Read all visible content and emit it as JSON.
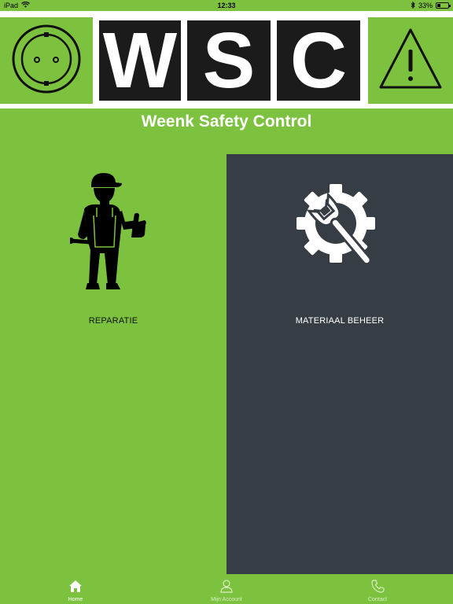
{
  "status_bar": {
    "device": "iPad",
    "time": "12:33",
    "battery": "33%",
    "battery_level": 0.33
  },
  "banner": {
    "logo_letters": [
      "W",
      "S",
      "C"
    ],
    "left_icon": "power-socket-icon",
    "right_icon": "warning-triangle-icon"
  },
  "title": "Weenk Safety Control",
  "tiles": [
    {
      "label": "REPARATIE",
      "icon": "worker-thumbs-up-icon"
    },
    {
      "label": "MATERIAAL BEHEER",
      "icon": "gear-wrench-icon"
    }
  ],
  "tab_bar": [
    {
      "label": "Home",
      "icon": "home-icon",
      "active": true
    },
    {
      "label": "Mijn Account",
      "icon": "user-icon",
      "active": false
    },
    {
      "label": "Contact",
      "icon": "phone-icon",
      "active": false
    }
  ],
  "colors": {
    "brand_green": "#7cc23f",
    "dark_panel": "#363d44",
    "logo_black": "#1b1b1b"
  }
}
